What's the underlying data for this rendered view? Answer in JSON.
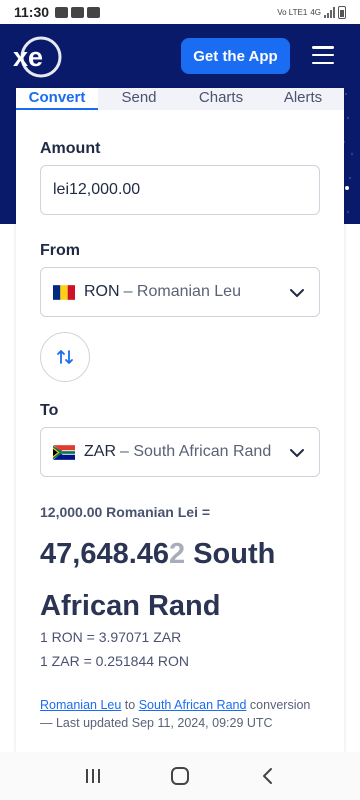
{
  "status_bar": {
    "time": "11:30",
    "net_label": "4G",
    "volte": "Vo LTE1"
  },
  "header": {
    "logo_text": "xe",
    "get_app_label": "Get the App"
  },
  "tabs": [
    {
      "label": "Convert",
      "active": true
    },
    {
      "label": "Send",
      "active": false
    },
    {
      "label": "Charts",
      "active": false
    },
    {
      "label": "Alerts",
      "active": false
    }
  ],
  "amount": {
    "label": "Amount",
    "value": "lei12,000.00"
  },
  "from": {
    "label": "From",
    "code": "RON",
    "name": "– Romanian Leu"
  },
  "to": {
    "label": "To",
    "code": "ZAR",
    "name": "– South African Rand"
  },
  "result": {
    "sub": "12,000.00 Romanian Lei =",
    "main_value": "47,648.46",
    "main_faded": "2",
    "main_unit": "South African Rand",
    "rate_1": "1 RON = 3.97071 ZAR",
    "rate_2": "1 ZAR = 0.251844 RON"
  },
  "footnote": {
    "link_from": "Romanian Leu",
    "to_word": "to",
    "link_to": "South African Rand",
    "conversion_word": "conversion",
    "updated": "— Last updated Sep 11, 2024, 09:29 UTC"
  },
  "colors": {
    "brand_navy": "#0a1a6b",
    "accent_blue": "#1a6df2"
  }
}
